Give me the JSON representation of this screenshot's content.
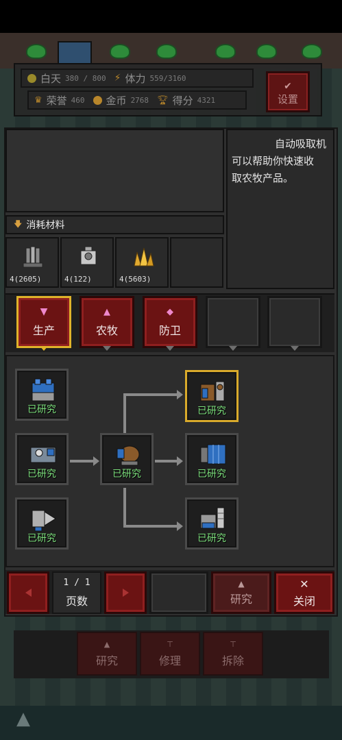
{
  "hud": {
    "day_label": "白天",
    "day_value": "380 / 800",
    "stamina_label": "体力",
    "stamina_value": "559/3160",
    "honor_label": "荣誉",
    "honor_value": "460",
    "gold_label": "金币",
    "gold_value": "2768",
    "score_label": "得分",
    "score_value": "4321",
    "settings_label": "设置"
  },
  "info": {
    "description_lines": [
      "自动吸取机",
      "可以帮助你快速收",
      "取农牧产品。"
    ],
    "materials_label": "消耗材料",
    "materials": [
      {
        "icon": "metal-pillars-icon",
        "count": "4(2605)"
      },
      {
        "icon": "machine-part-icon",
        "count": "4(122)"
      },
      {
        "icon": "gold-crystal-icon",
        "count": "4(5603)"
      },
      {
        "icon": "",
        "count": ""
      }
    ]
  },
  "tabs": [
    {
      "label": "生产",
      "icon": "anvil-icon",
      "active": true
    },
    {
      "label": "农牧",
      "icon": "tree-icon",
      "active": false
    },
    {
      "label": "防卫",
      "icon": "shield-icon",
      "active": false
    },
    {
      "label": "",
      "icon": "",
      "active": false
    },
    {
      "label": "",
      "icon": "",
      "active": false
    }
  ],
  "tree": {
    "nodes": [
      {
        "id": "n1",
        "label": "已研究",
        "icon": "blue-workbench-icon"
      },
      {
        "id": "n2",
        "label": "已研究",
        "icon": "generator-machine-icon"
      },
      {
        "id": "n3",
        "label": "已研究",
        "icon": "drill-machine-icon"
      },
      {
        "id": "n4",
        "label": "已研究",
        "icon": "coil-machine-icon"
      },
      {
        "id": "n5",
        "label": "已研究",
        "icon": "absorber-machine-icon",
        "selected": true
      },
      {
        "id": "n6",
        "label": "已研究",
        "icon": "blue-panel-machine-icon"
      },
      {
        "id": "n7",
        "label": "已研究",
        "icon": "spring-press-icon"
      }
    ]
  },
  "pager": {
    "page": "1 / 1",
    "label": "页数"
  },
  "actions": {
    "research": "研究",
    "close": "关闭"
  },
  "underbar": {
    "research": "研究",
    "repair": "修理",
    "demolish": "拆除"
  }
}
